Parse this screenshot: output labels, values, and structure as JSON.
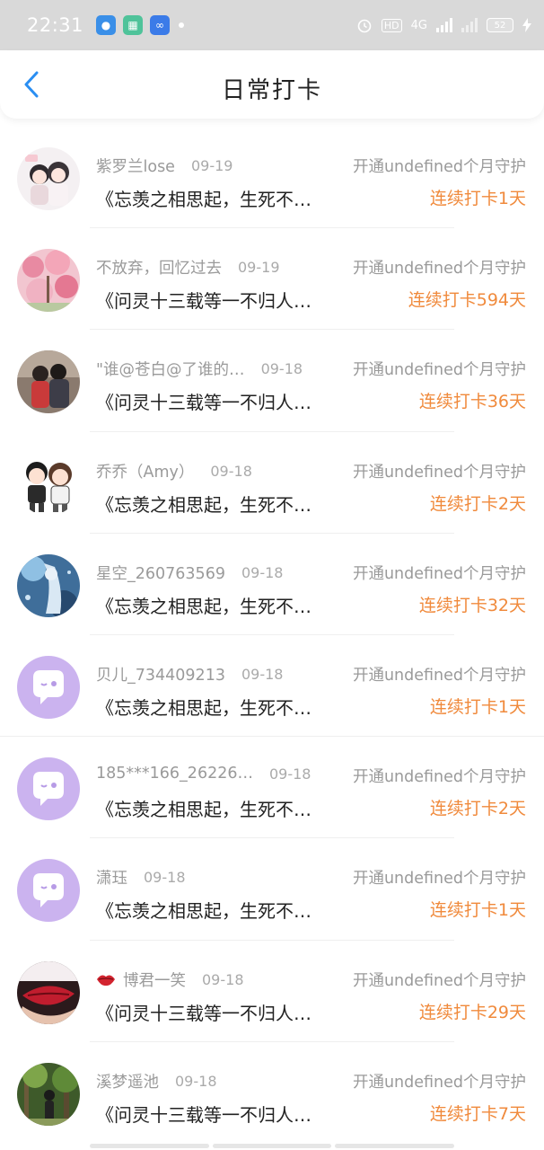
{
  "status_bar": {
    "time": "22:31",
    "hd": "HD",
    "network": "4G",
    "battery": "52"
  },
  "header": {
    "title": "日常打卡",
    "back_icon": "chevron-left-icon"
  },
  "colors": {
    "streak": "#f08a3c",
    "back": "#2a8ef2",
    "default_avatar": "#cbb3ef"
  },
  "rows": [
    {
      "name": "紫罗兰lose",
      "date": "09-19",
      "guard": "开通undefined个月守护",
      "content": "《忘羡之相思起，生死不…",
      "streak": "连续打卡1天"
    },
    {
      "name": "不放弃，回忆过去",
      "date": "09-19",
      "guard": "开通undefined个月守护",
      "content": "《问灵十三载等一不归人…",
      "streak": "连续打卡594天"
    },
    {
      "name": "\"谁@苍白@了谁的…",
      "date": "09-18",
      "guard": "开通undefined个月守护",
      "content": "《问灵十三载等一不归人…",
      "streak": "连续打卡36天"
    },
    {
      "name": "乔乔（Amy）",
      "date": "09-18",
      "guard": "开通undefined个月守护",
      "content": "《忘羡之相思起，生死不…",
      "streak": "连续打卡2天"
    },
    {
      "name": "星空_260763569",
      "date": "09-18",
      "guard": "开通undefined个月守护",
      "content": "《忘羡之相思起，生死不…",
      "streak": "连续打卡32天"
    },
    {
      "name": "贝儿_734409213",
      "date": "09-18",
      "guard": "开通undefined个月守护",
      "content": "《忘羡之相思起，生死不…",
      "streak": "连续打卡1天"
    },
    {
      "name": "185***166_26226…",
      "date": "09-18",
      "guard": "开通undefined个月守护",
      "content": "《忘羡之相思起，生死不…",
      "streak": "连续打卡2天"
    },
    {
      "name": "潇珏",
      "date": "09-18",
      "guard": "开通undefined个月守护",
      "content": "《忘羡之相思起，生死不…",
      "streak": "连续打卡1天"
    },
    {
      "name": "博君一笑",
      "date": "09-18",
      "guard": "开通undefined个月守护",
      "content": "《问灵十三载等一不归人…",
      "streak": "连续打卡29天"
    },
    {
      "name": "溪梦遥池",
      "date": "09-18",
      "guard": "开通undefined个月守护",
      "content": "《问灵十三载等一不归人…",
      "streak": "连续打卡7天"
    }
  ]
}
